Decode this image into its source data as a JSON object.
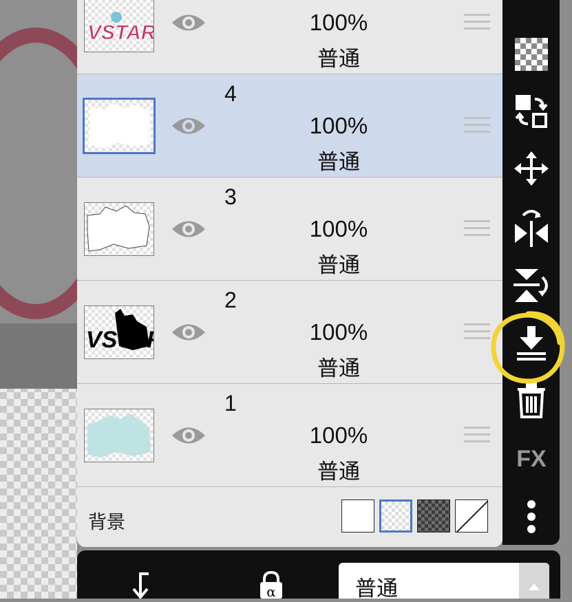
{
  "layers": [
    {
      "number": "",
      "opacity": "100%",
      "blend": "普通",
      "thumb": "VSTAR"
    },
    {
      "number": "4",
      "opacity": "100%",
      "blend": "普通",
      "selected": true
    },
    {
      "number": "3",
      "opacity": "100%",
      "blend": "普通"
    },
    {
      "number": "2",
      "opacity": "100%",
      "blend": "普通",
      "thumb": "VSTAR"
    },
    {
      "number": "1",
      "opacity": "100%",
      "blend": "普通"
    }
  ],
  "background_row": {
    "label": "背景"
  },
  "toolbar": {
    "fx_label": "FX"
  },
  "bottom_bar": {
    "blend_mode": "普通",
    "alpha_lock_label": "α"
  },
  "colors": {
    "selected_row": "#cfd9ec",
    "accent_blue": "#4e78c4",
    "highlight_yellow": "#f2d534",
    "toolbar_bg": "#101010"
  }
}
